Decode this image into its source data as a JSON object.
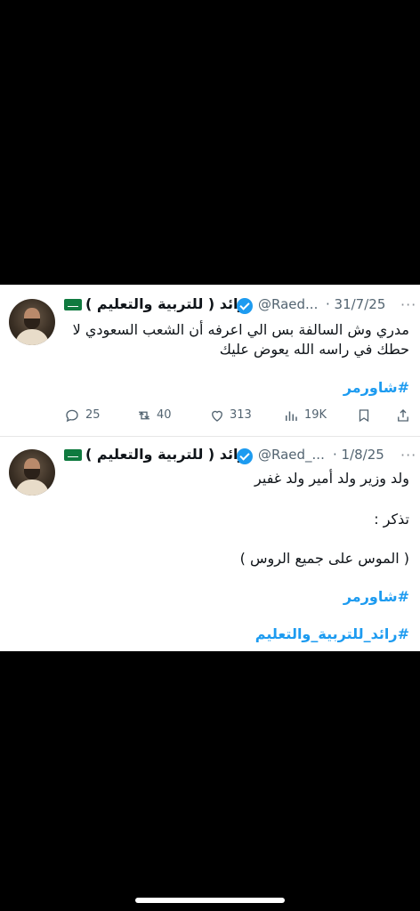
{
  "tweets": [
    {
      "name": "رائد ( للتربية والتعليم )",
      "handle": "@Raed...",
      "date": "· 31/7/25",
      "more": "···",
      "text_line1": "مدري وش السالفة بس الي اعرفه أن الشعب السعودي لا",
      "text_line2": "حطك في راسه الله يعوض عليك",
      "hashtag1": "#شاورمر",
      "actions": {
        "replies": "25",
        "reposts": "40",
        "likes": "313",
        "views": "19K"
      }
    },
    {
      "name": "رائد ( للتربية والتعليم )",
      "handle": "@Raed_...",
      "date": "· 1/8/25",
      "more": "···",
      "line1": "ولد وزير ولد أمير ولد غفير",
      "line2": "تذكر :",
      "line3": "( الموس على جميع الروس )",
      "hashtag1": "#شاورمر",
      "hashtag2": "#رائد_للتربية_والتعليم"
    }
  ],
  "icons": [
    "reply-icon",
    "repost-icon",
    "like-icon",
    "views-icon",
    "bookmark-icon",
    "share-icon",
    "verified-icon",
    "saudi-flag-icon"
  ],
  "colors": {
    "accent": "#1d9bf0",
    "text": "#0f1419",
    "muted": "#536471",
    "background": "#000000"
  }
}
